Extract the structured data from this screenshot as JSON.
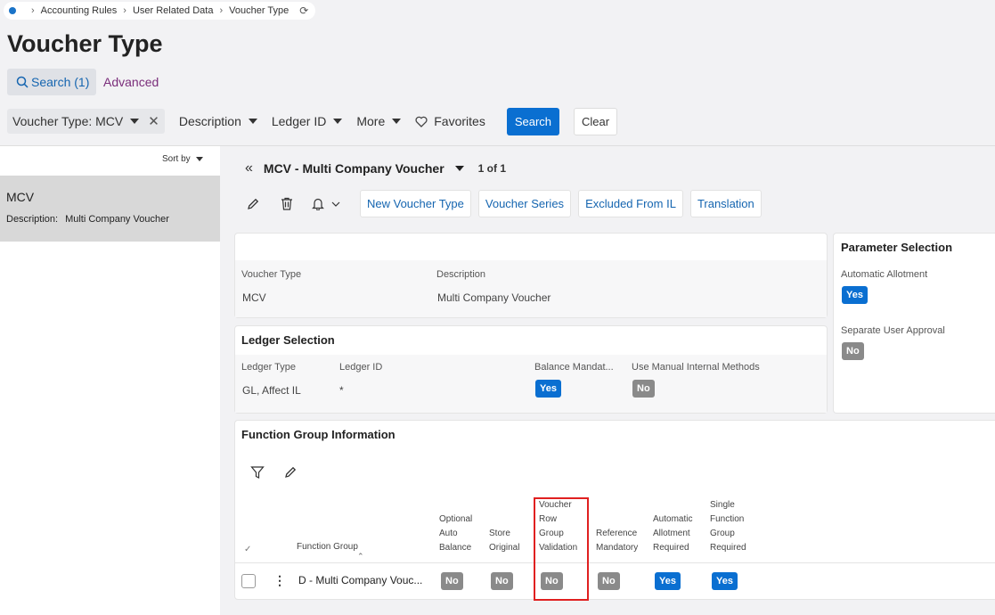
{
  "breadcrumb": {
    "items": [
      "Accounting Rules",
      "User Related Data",
      "Voucher Type"
    ]
  },
  "page": {
    "title": "Voucher Type"
  },
  "search": {
    "tab_label": "Search (1)",
    "advanced_label": "Advanced",
    "filter_chip": "Voucher Type: MCV",
    "filters": [
      "Description",
      "Ledger ID",
      "More"
    ],
    "favorites": "Favorites",
    "search_button": "Search",
    "clear_button": "Clear"
  },
  "list": {
    "sort_label": "Sort by",
    "item": {
      "code": "MCV",
      "desc_label": "Description:",
      "desc_value": "Multi Company Voucher"
    }
  },
  "record": {
    "title": "MCV - Multi Company Voucher",
    "count": "1 of 1"
  },
  "toolbar": {
    "buttons": [
      "New Voucher Type",
      "Voucher Series",
      "Excluded From IL",
      "Translation"
    ]
  },
  "general": {
    "voucher_type_label": "Voucher Type",
    "voucher_type_value": "MCV",
    "description_label": "Description",
    "description_value": "Multi Company Voucher"
  },
  "ledger": {
    "title": "Ledger Selection",
    "ledger_type_label": "Ledger Type",
    "ledger_type_value": "GL, Affect IL",
    "ledger_id_label": "Ledger ID",
    "ledger_id_value": "*",
    "balance_label": "Balance Mandat...",
    "balance_value": "Yes",
    "manual_label": "Use Manual Internal Methods",
    "manual_value": "No"
  },
  "parameter": {
    "title": "Parameter Selection",
    "auto_allot_label": "Automatic Allotment",
    "auto_allot_value": "Yes",
    "separate_label": "Separate User Approval",
    "separate_value": "No"
  },
  "function_group": {
    "title": "Function Group Information",
    "columns": {
      "function_group": "Function Group",
      "optional_auto_balance": [
        "Optional",
        "Auto",
        "Balance"
      ],
      "store_original": [
        "Store",
        "Original"
      ],
      "voucher_row_group_validation": [
        "Voucher",
        "Row",
        "Group",
        "Validation"
      ],
      "reference_mandatory": [
        "Reference",
        "Mandatory"
      ],
      "automatic_allotment_required": [
        "Automatic",
        "Allotment",
        "Required"
      ],
      "single_function_group_required": [
        "Single",
        "Function",
        "Group",
        "Required"
      ]
    },
    "row": {
      "function_group": "D - Multi Company Vouc...",
      "optional_auto_balance": "No",
      "store_original": "No",
      "voucher_row_group_validation": "No",
      "reference_mandatory": "No",
      "automatic_allotment_required": "Yes",
      "single_function_group_required": "Yes"
    }
  },
  "colors": {
    "accent": "#0a6fd1",
    "highlight": "#e02020"
  }
}
